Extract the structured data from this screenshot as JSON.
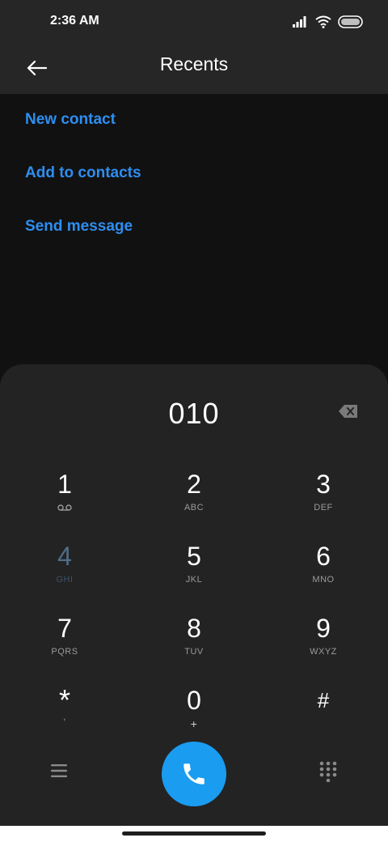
{
  "status_bar": {
    "time": "2:36 AM",
    "icons": [
      "signal-icon",
      "wifi-icon",
      "battery-icon"
    ]
  },
  "header": {
    "title": "Recents",
    "back_icon": "arrow-left-icon"
  },
  "actions": [
    {
      "label": "New contact"
    },
    {
      "label": "Add to contacts"
    },
    {
      "label": "Send message"
    }
  ],
  "dialer": {
    "number": "010",
    "backspace_icon": "backspace-icon",
    "keys": [
      {
        "digit": "1",
        "letters": "",
        "sub_icon": "voicemail-icon"
      },
      {
        "digit": "2",
        "letters": "ABC"
      },
      {
        "digit": "3",
        "letters": "DEF"
      },
      {
        "digit": "4",
        "letters": "GHI"
      },
      {
        "digit": "5",
        "letters": "JKL"
      },
      {
        "digit": "6",
        "letters": "MNO"
      },
      {
        "digit": "7",
        "letters": "PQRS"
      },
      {
        "digit": "8",
        "letters": "TUV"
      },
      {
        "digit": "9",
        "letters": "WXYZ"
      },
      {
        "digit": "*",
        "letters": ","
      },
      {
        "digit": "0",
        "letters": "+"
      },
      {
        "digit": "#",
        "letters": ""
      }
    ],
    "menu_icon": "menu-icon",
    "call_icon": "phone-icon",
    "dialpad_icon": "dialpad-icon"
  },
  "colors": {
    "accent": "#2e8ef0",
    "call_button": "#1a9cf0",
    "background": "#111111",
    "panel": "#232323",
    "header": "#262626"
  }
}
